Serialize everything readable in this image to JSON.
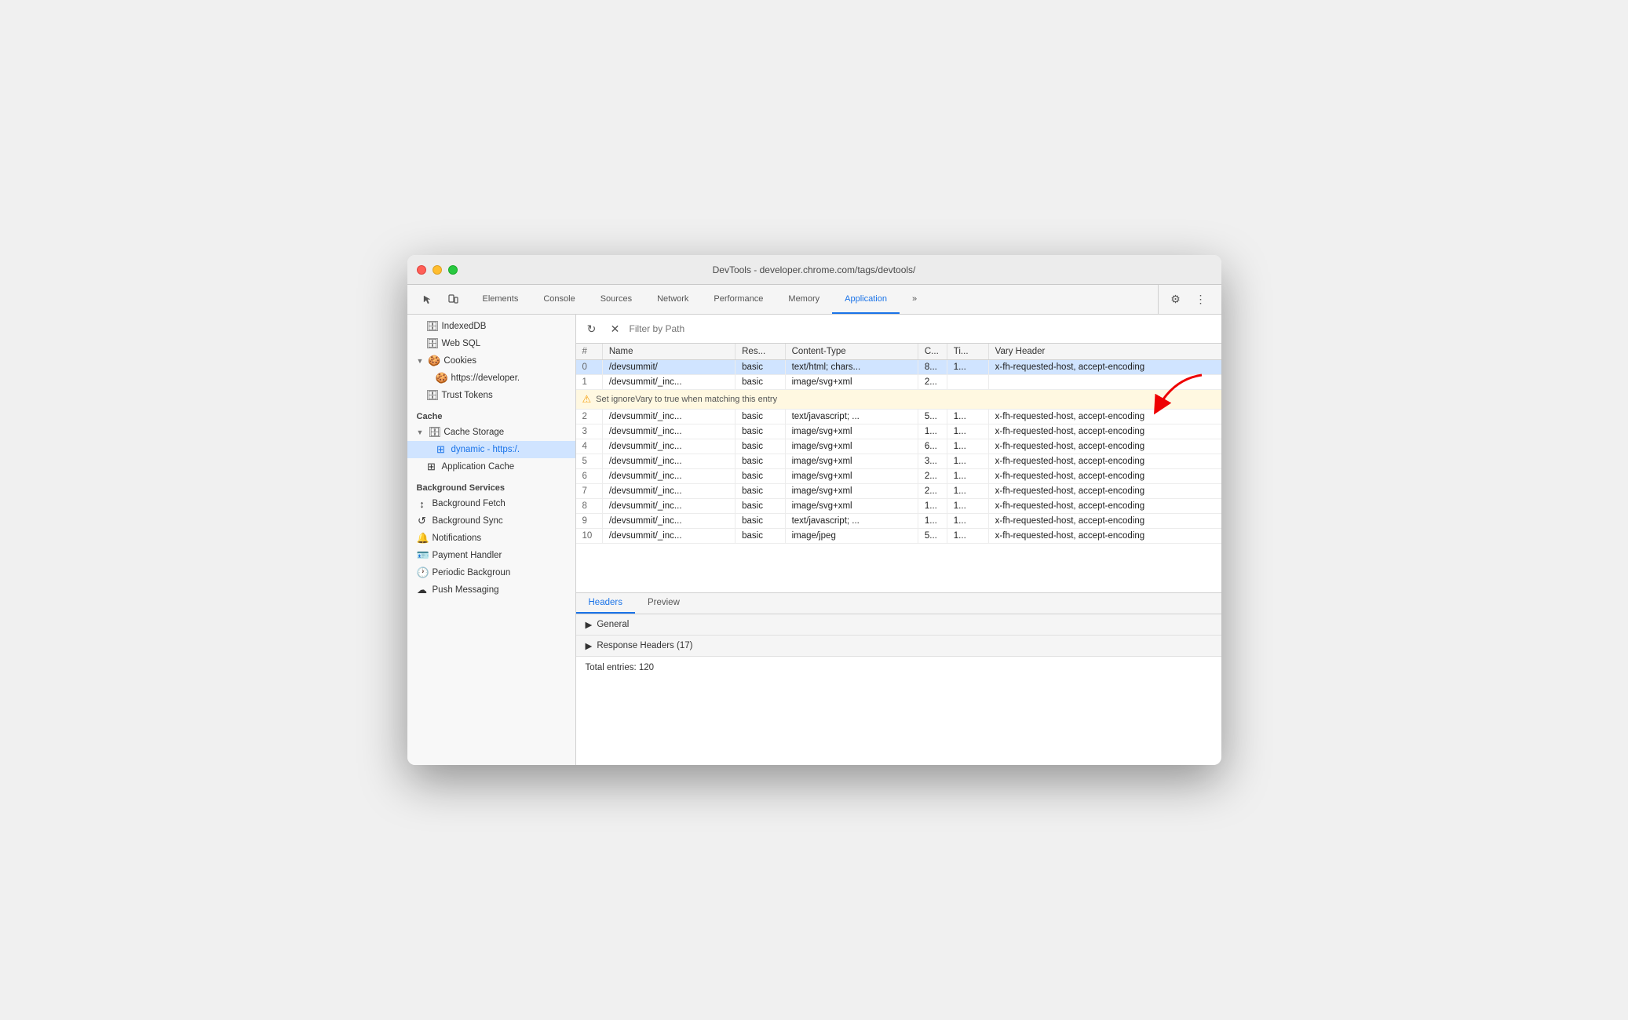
{
  "window": {
    "title": "DevTools - developer.chrome.com/tags/devtools/"
  },
  "tabs": [
    {
      "label": "Elements",
      "active": false
    },
    {
      "label": "Console",
      "active": false
    },
    {
      "label": "Sources",
      "active": false
    },
    {
      "label": "Network",
      "active": false
    },
    {
      "label": "Performance",
      "active": false
    },
    {
      "label": "Memory",
      "active": false
    },
    {
      "label": "Application",
      "active": true
    }
  ],
  "sidebar": {
    "items": [
      {
        "label": "IndexedDB",
        "indent": 1,
        "icon": "🗄"
      },
      {
        "label": "Web SQL",
        "indent": 1,
        "icon": "🗄"
      },
      {
        "label": "Cookies",
        "indent": 0,
        "icon": "🍪",
        "arrow": true
      },
      {
        "label": "https://developer.",
        "indent": 2,
        "icon": "🍪"
      },
      {
        "label": "Trust Tokens",
        "indent": 1,
        "icon": "🗄"
      },
      {
        "label": "Cache",
        "section": true
      },
      {
        "label": "Cache Storage",
        "indent": 0,
        "icon": "🗄",
        "arrow": true
      },
      {
        "label": "dynamic - https:/.",
        "indent": 2,
        "icon": "⊞",
        "selected": true
      },
      {
        "label": "Application Cache",
        "indent": 1,
        "icon": "⊞"
      },
      {
        "label": "Background Services",
        "section": true
      },
      {
        "label": "Background Fetch",
        "indent": 0,
        "icon": "↕"
      },
      {
        "label": "Background Sync",
        "indent": 0,
        "icon": "↺"
      },
      {
        "label": "Notifications",
        "indent": 0,
        "icon": "🔔"
      },
      {
        "label": "Payment Handler",
        "indent": 0,
        "icon": "🪪"
      },
      {
        "label": "Periodic Backgroun",
        "indent": 0,
        "icon": "🕐"
      },
      {
        "label": "Push Messaging",
        "indent": 0,
        "icon": "☁"
      }
    ]
  },
  "filter": {
    "placeholder": "Filter by Path"
  },
  "table": {
    "columns": [
      "#",
      "Name",
      "Res...",
      "Content-Type",
      "C...",
      "Ti...",
      "Vary Header"
    ],
    "rows": [
      {
        "num": "0",
        "name": "/devsummit/",
        "res": "basic",
        "ct": "text/html; chars...",
        "c": "8...",
        "ti": "1...",
        "vary": "x-fh-requested-host, accept-encoding",
        "selected": true
      },
      {
        "num": "1",
        "name": "/devsummit/_inc...",
        "res": "basic",
        "ct": "image/svg+xml",
        "c": "2...",
        "ti": "",
        "vary": "",
        "tooltip": true
      },
      {
        "num": "2",
        "name": "/devsummit/_inc...",
        "res": "basic",
        "ct": "text/javascript; ...",
        "c": "5...",
        "ti": "1...",
        "vary": "x-fh-requested-host, accept-encoding"
      },
      {
        "num": "3",
        "name": "/devsummit/_inc...",
        "res": "basic",
        "ct": "image/svg+xml",
        "c": "1...",
        "ti": "1...",
        "vary": "x-fh-requested-host, accept-encoding"
      },
      {
        "num": "4",
        "name": "/devsummit/_inc...",
        "res": "basic",
        "ct": "image/svg+xml",
        "c": "6...",
        "ti": "1...",
        "vary": "x-fh-requested-host, accept-encoding"
      },
      {
        "num": "5",
        "name": "/devsummit/_inc...",
        "res": "basic",
        "ct": "image/svg+xml",
        "c": "3...",
        "ti": "1...",
        "vary": "x-fh-requested-host, accept-encoding"
      },
      {
        "num": "6",
        "name": "/devsummit/_inc...",
        "res": "basic",
        "ct": "image/svg+xml",
        "c": "2...",
        "ti": "1...",
        "vary": "x-fh-requested-host, accept-encoding"
      },
      {
        "num": "7",
        "name": "/devsummit/_inc...",
        "res": "basic",
        "ct": "image/svg+xml",
        "c": "2...",
        "ti": "1...",
        "vary": "x-fh-requested-host, accept-encoding"
      },
      {
        "num": "8",
        "name": "/devsummit/_inc...",
        "res": "basic",
        "ct": "image/svg+xml",
        "c": "1...",
        "ti": "1...",
        "vary": "x-fh-requested-host, accept-encoding"
      },
      {
        "num": "9",
        "name": "/devsummit/_inc...",
        "res": "basic",
        "ct": "text/javascript; ...",
        "c": "1...",
        "ti": "1...",
        "vary": "x-fh-requested-host, accept-encoding"
      },
      {
        "num": "10",
        "name": "/devsummit/_inc...",
        "res": "basic",
        "ct": "image/jpeg",
        "c": "5...",
        "ti": "1...",
        "vary": "x-fh-requested-host, accept-encoding"
      }
    ],
    "tooltip_text": "Set ignoreVary to true when matching this entry"
  },
  "bottom_tabs": [
    "Headers",
    "Preview"
  ],
  "sections": [
    {
      "label": "General"
    },
    {
      "label": "Response Headers (17)"
    }
  ],
  "total_entries": "Total entries: 120"
}
